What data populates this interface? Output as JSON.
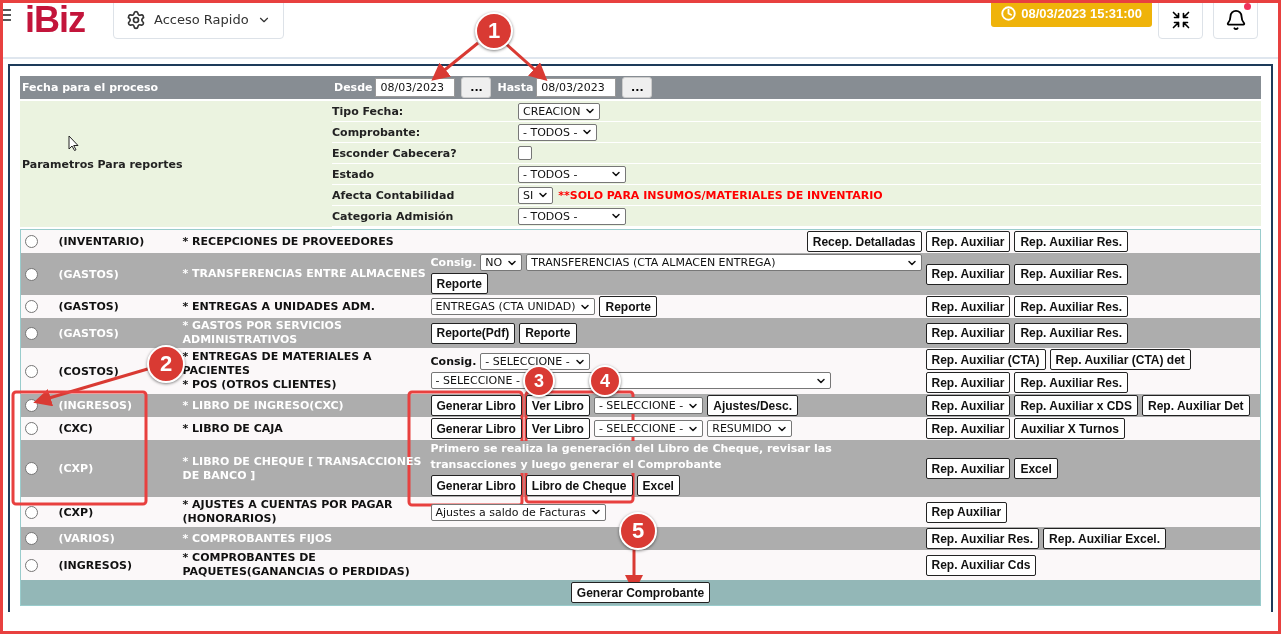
{
  "header": {
    "logo": "iBiz",
    "quick_access": "Acceso Rapido",
    "clock": "08/03/2023 15:31:00",
    "notification_dot": true
  },
  "process_date": {
    "title": "Fecha para el proceso",
    "from_label": "Desde",
    "from": "08/03/2023",
    "from_button": "...",
    "to_label": "Hasta",
    "to": "08/03/2023",
    "to_button": "..."
  },
  "parameters": {
    "title": "Parametros Para reportes",
    "fields": [
      {
        "label": "Tipo Fecha:",
        "kind": "select",
        "value": "CREACION"
      },
      {
        "label": "Comprobante:",
        "kind": "select",
        "value": "- TODOS -"
      },
      {
        "label": "Esconder Cabecera?",
        "kind": "checkbox",
        "checked": false
      },
      {
        "label": "Estado",
        "kind": "select",
        "value": "- TODOS -",
        "wide": true
      },
      {
        "label": "Afecta Contabilidad",
        "kind": "select",
        "value": "SI",
        "note": "**SOLO PARA INSUMOS/MATERIALES DE INVENTARIO"
      },
      {
        "label": "Categoria Admisión",
        "kind": "select",
        "value": "- TODOS -",
        "wide": true
      }
    ]
  },
  "reports": [
    {
      "selected": false,
      "category": "(INVENTARIO)",
      "names": [
        "* RECEPCIONES DE PROVEEDORES"
      ],
      "middle": [
        [
          {
            "kind": "end-button",
            "text": "Recep. Detalladas"
          }
        ]
      ],
      "right": [
        [
          "Rep. Auxiliar",
          "Rep. Auxiliar Res."
        ]
      ]
    },
    {
      "selected": false,
      "category": "(GASTOS)",
      "names": [
        "* TRANSFERENCIAS ENTRE ALMACENES"
      ],
      "middle": [
        [
          {
            "kind": "label",
            "text": "Consig."
          },
          {
            "kind": "select",
            "text": "NO"
          },
          {
            "kind": "wide-select",
            "text": "TRANSFERENCIAS (CTA ALMACEN ENTREGA)"
          }
        ],
        [
          {
            "kind": "button",
            "text": "Reporte"
          }
        ]
      ],
      "right": [
        [
          "Rep. Auxiliar",
          "Rep. Auxiliar Res."
        ]
      ]
    },
    {
      "selected": false,
      "category": "(GASTOS)",
      "names": [
        "* ENTREGAS A UNIDADES ADM."
      ],
      "middle": [
        [
          {
            "kind": "select",
            "text": "ENTREGAS (CTA UNIDAD)"
          },
          {
            "kind": "button",
            "text": "Reporte"
          }
        ]
      ],
      "right": [
        [
          "Rep. Auxiliar",
          "Rep. Auxiliar Res."
        ]
      ]
    },
    {
      "selected": false,
      "category": "(GASTOS)",
      "names": [
        "* GASTOS POR SERVICIOS ADMINISTRATIVOS"
      ],
      "middle": [
        [
          {
            "kind": "button",
            "text": "Reporte(Pdf)"
          },
          {
            "kind": "button",
            "text": "Reporte"
          }
        ]
      ],
      "right": [
        [
          "Rep. Auxiliar",
          "Rep. Auxiliar Res."
        ]
      ]
    },
    {
      "selected": false,
      "category": "(COSTOS)",
      "names": [
        "* ENTREGAS DE MATERIALES A PACIENTES",
        "* POS (OTROS CLIENTES)"
      ],
      "middle": [
        [
          {
            "kind": "label",
            "text": "Consig."
          },
          {
            "kind": "select",
            "text": "- SELECCIONE -"
          }
        ],
        [
          {
            "kind": "wide-select",
            "text": "- SELECCIONE -"
          }
        ]
      ],
      "right": [
        [
          "Rep. Auxiliar (CTA)",
          "Rep. Auxiliar (CTA) det"
        ],
        [
          "Rep. Auxiliar",
          "Rep. Auxiliar Res."
        ]
      ]
    },
    {
      "selected": false,
      "category": "(INGRESOS)",
      "names": [
        "* LIBRO DE INGRESO(CXC)"
      ],
      "middle": [
        [
          {
            "kind": "button",
            "text": "Generar Libro"
          },
          {
            "kind": "button",
            "text": "Ver Libro"
          },
          {
            "kind": "select",
            "text": "- SELECCIONE -"
          },
          {
            "kind": "button",
            "text": "Ajustes/Desc."
          }
        ]
      ],
      "right": [
        [
          "Rep. Auxiliar",
          "Rep. Auxiliar x CDS",
          "Rep. Auxiliar Det"
        ]
      ]
    },
    {
      "selected": false,
      "category": "(CXC)",
      "names": [
        "* LIBRO DE CAJA"
      ],
      "middle": [
        [
          {
            "kind": "button",
            "text": "Generar Libro"
          },
          {
            "kind": "button",
            "text": "Ver Libro"
          },
          {
            "kind": "select",
            "text": "- SELECCIONE -"
          },
          {
            "kind": "select",
            "text": "RESUMIDO"
          }
        ]
      ],
      "right": [
        [
          "Rep. Auxiliar",
          "Auxiliar X Turnos"
        ]
      ]
    },
    {
      "selected": false,
      "category": "(CXP)",
      "names": [
        "* LIBRO DE CHEQUE [ TRANSACCIONES DE BANCO ]"
      ],
      "middle": [
        [
          {
            "kind": "note",
            "text": "Primero se realiza la generación del Libro de Cheque, revisar las transacciones y luego generar el Comprobante"
          }
        ],
        [
          {
            "kind": "button",
            "text": "Generar Libro"
          },
          {
            "kind": "button",
            "text": "Libro de Cheque"
          },
          {
            "kind": "button",
            "text": "Excel"
          }
        ]
      ],
      "right": [
        [
          "Rep. Auxiliar",
          "Excel"
        ]
      ]
    },
    {
      "selected": false,
      "category": "(CXP)",
      "names": [
        "* AJUSTES A CUENTAS POR PAGAR (HONORARIOS)"
      ],
      "middle": [
        [
          {
            "kind": "select",
            "text": "Ajustes a saldo de Facturas"
          }
        ]
      ],
      "right": [
        [
          "Rep Auxiliar"
        ]
      ]
    },
    {
      "selected": false,
      "category": "(VARIOS)",
      "names": [
        "* COMPROBANTES FIJOS"
      ],
      "right": [
        [
          "Rep. Auxiliar Res.",
          "Rep. Auxiliar Excel."
        ]
      ]
    },
    {
      "selected": false,
      "category": "(INGRESOS)",
      "names": [
        "* COMPROBANTES DE PAQUETES(GANANCIAS O PERDIDAS)"
      ],
      "right": [
        [
          "Rep. Auxiliar Cds"
        ]
      ]
    }
  ],
  "footer": {
    "button": "Generar Comprobante"
  },
  "annotations": [
    {
      "number": "1"
    },
    {
      "number": "2"
    },
    {
      "number": "3"
    },
    {
      "number": "4"
    },
    {
      "number": "5"
    }
  ]
}
